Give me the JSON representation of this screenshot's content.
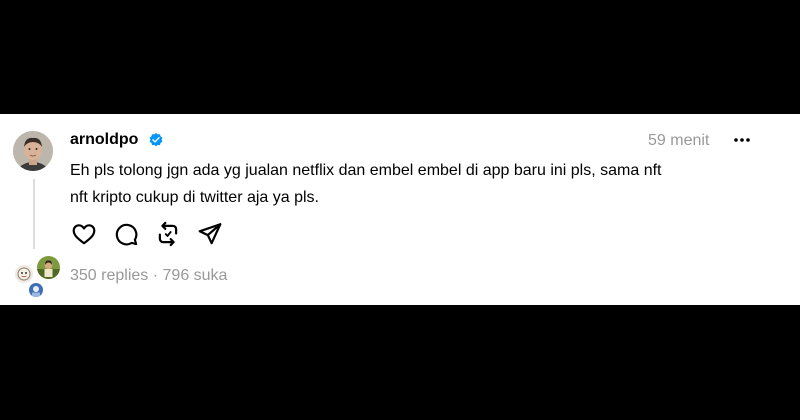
{
  "post": {
    "username": "arnoldpo",
    "verified_icon": "verified-badge-icon",
    "time": "59 menit",
    "more_icon": "more-options-icon",
    "text_line1": "Eh pls tolong jgn ada yg jualan netflix dan embel embel di app baru ini pls, sama nft",
    "text_line2": "nft kripto cukup di twitter aja ya pls."
  },
  "actions": {
    "icons": [
      "heart-icon",
      "comment-icon",
      "repost-icon",
      "share-icon"
    ]
  },
  "stats": {
    "replies": "350 replies",
    "separator": "·",
    "likes": "796 suka"
  },
  "colors": {
    "background": "#000000",
    "card": "#ffffff",
    "text": "#000000",
    "muted": "#999999",
    "verified": "#0095f6"
  }
}
